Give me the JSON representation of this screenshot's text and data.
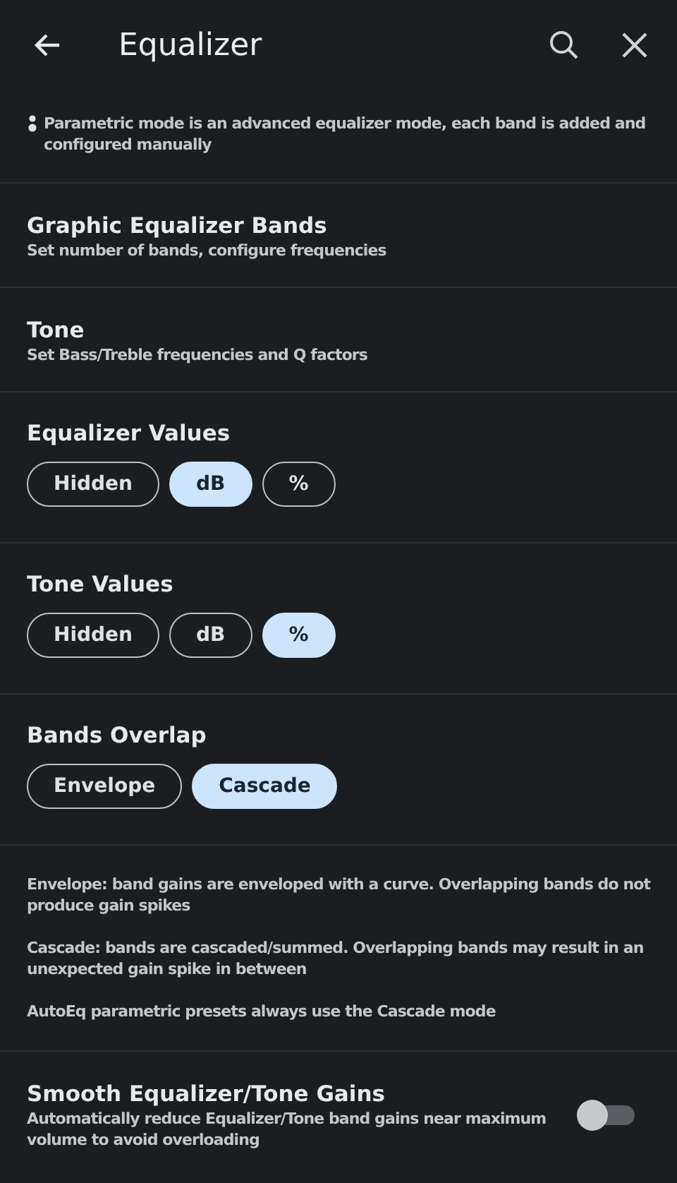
{
  "header": {
    "title": "Equalizer"
  },
  "sections": [
    {
      "kind": "note",
      "text": "Parametric mode is an advanced equalizer mode, each band is added and configured manually"
    },
    {
      "kind": "link",
      "title": "Graphic Equalizer Bands",
      "subtitle": "Set number of bands, configure frequencies"
    },
    {
      "kind": "link",
      "title": "Tone",
      "subtitle": "Set Bass/Treble frequencies and Q factors"
    },
    {
      "kind": "choice",
      "title": "Equalizer Values",
      "options": [
        {
          "label": "Hidden",
          "selected": false
        },
        {
          "label": "dB",
          "selected": true
        },
        {
          "label": "%",
          "selected": false
        }
      ]
    },
    {
      "kind": "choice",
      "title": "Tone Values",
      "options": [
        {
          "label": "Hidden",
          "selected": false
        },
        {
          "label": "dB",
          "selected": false
        },
        {
          "label": "%",
          "selected": true
        }
      ]
    },
    {
      "kind": "choice",
      "title": "Bands Overlap",
      "options": [
        {
          "label": "Envelope",
          "selected": false
        },
        {
          "label": "Cascade",
          "selected": true
        }
      ]
    },
    {
      "kind": "info",
      "paragraphs": [
        "Envelope: band gains are enveloped with a curve. Overlapping bands do not produce gain spikes",
        "Cascade: bands are cascaded/summed. Overlapping bands may result in an unexpected gain spike in between",
        "AutoEq parametric presets always use the Cascade mode"
      ]
    },
    {
      "kind": "toggle",
      "title": "Smooth Equalizer/Tone Gains",
      "subtitle": "Automatically reduce Equalizer/Tone band gains near maximum volume to avoid overloading",
      "on": false
    }
  ]
}
